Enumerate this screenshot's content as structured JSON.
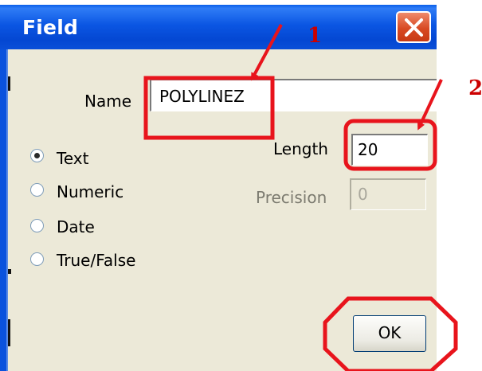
{
  "dialog": {
    "title": "Field",
    "name_label": "Name",
    "name_value": "POLYLINEZ",
    "length_label": "Length",
    "length_value": "20",
    "precision_label": "Precision",
    "precision_value": "0",
    "ok_label": "OK"
  },
  "types": [
    {
      "label": "Text",
      "selected": true
    },
    {
      "label": "Numeric",
      "selected": false
    },
    {
      "label": "Date",
      "selected": false
    },
    {
      "label": "True/False",
      "selected": false
    }
  ],
  "annotations": {
    "step1": "1",
    "step2": "2",
    "color": "#e8141c"
  },
  "colors": {
    "titlebar": "#0b56e3",
    "client_bg": "#ece9d8",
    "close_button": "#d84a23"
  }
}
